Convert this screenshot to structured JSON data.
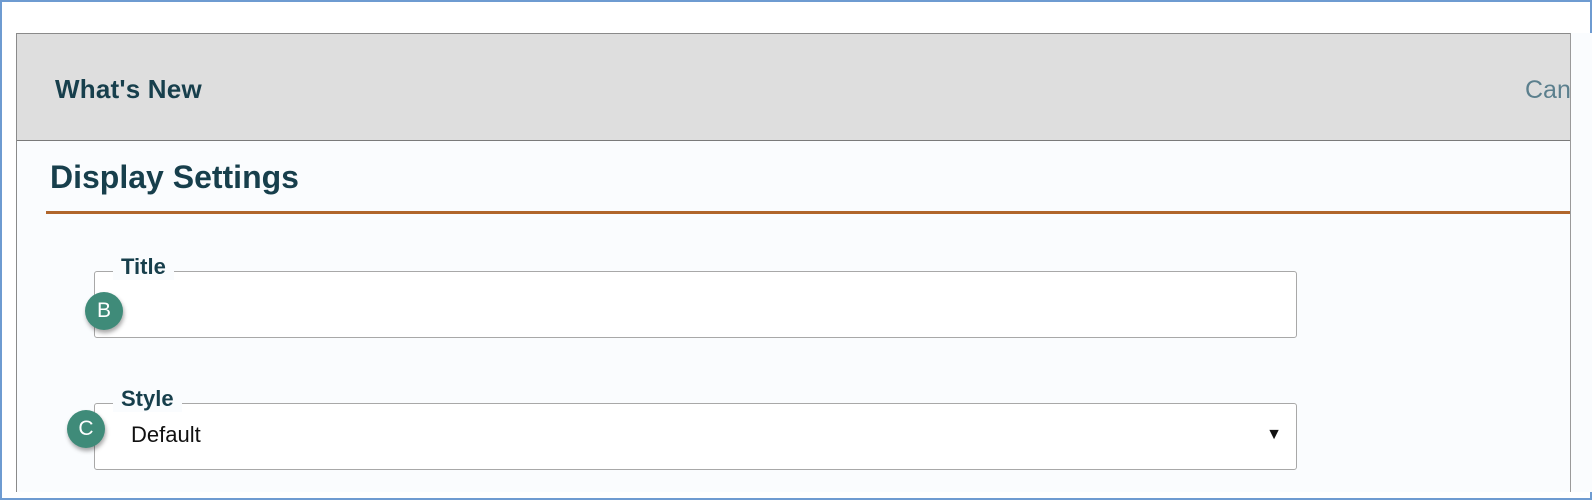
{
  "header": {
    "title": "What's New",
    "cancel_label": "Can"
  },
  "section": {
    "title": "Display Settings"
  },
  "fields": {
    "title": {
      "label": "Title",
      "value": ""
    },
    "style": {
      "label": "Style",
      "selected": "Default",
      "arrow": "▼"
    }
  },
  "markers": {
    "b": "B",
    "c": "C"
  },
  "colors": {
    "heading": "#173f4c",
    "accent_rule": "#b0662c",
    "header_bg": "#dedede",
    "marker_bg": "#3f8b79",
    "frame_border": "#6e9bd1"
  }
}
